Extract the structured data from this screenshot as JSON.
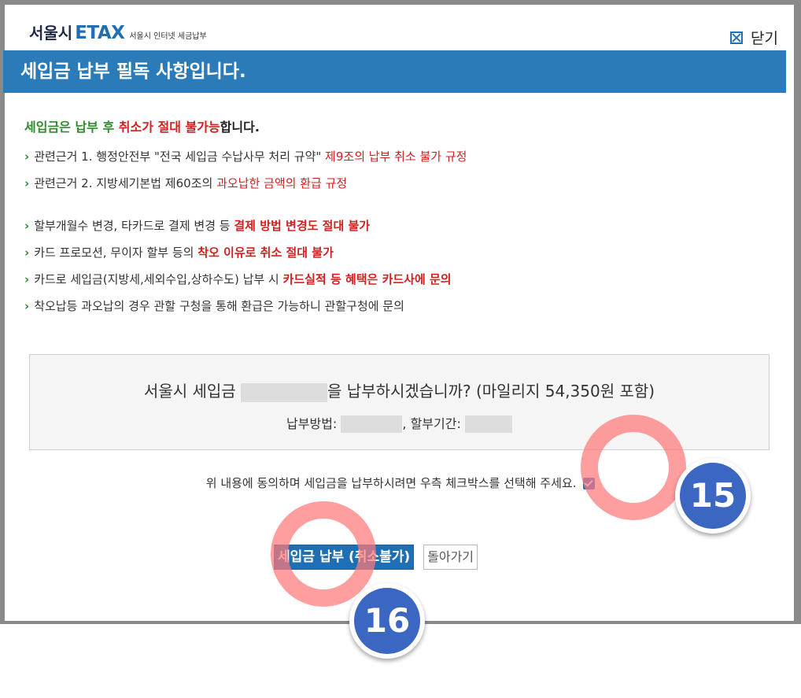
{
  "header": {
    "logo_seoul": "서울시",
    "logo_etax": "ETAX",
    "logo_sub": "서울시 인터넷 세금납부",
    "close_label": "닫기"
  },
  "title": "세입금 납부 필독 사항입니다.",
  "notice": {
    "headline_a": "세입금은 납부 후 ",
    "headline_b": "취소가 절대 불가능",
    "headline_c": "합니다.",
    "items": [
      {
        "text": "관련근거 1. 행정안전부 \"전국 세입금 수납사무 처리 규약\" ",
        "highlight": "제9조의 납부 취소 불가 규정"
      },
      {
        "text": "관련근거 2. 지방세기본법 제60조의 ",
        "highlight": "과오납한 금액의 환급 규정"
      },
      {
        "text": "할부개월수 변경, 타카드로 결제 변경 등 ",
        "highlight": "결제 방법 변경도 절대 불가"
      },
      {
        "text": "카드 프로모션, 무이자 할부 등의 ",
        "highlight": "착오 이유로 취소 절대 불가"
      },
      {
        "text": "카드로 세입금(지방세,세외수입,상하수도) 납부 시 ",
        "highlight": "카드실적 등 혜택은 카드사에 문의"
      },
      {
        "text": "착오납등 과오납의 경우 관할 구청을 통해 환급은 가능하니 관할구청에 문의",
        "highlight": ""
      }
    ]
  },
  "confirm": {
    "main_prefix": "서울시 세입금 ",
    "main_suffix": "을 납부하시겠습니까? (마일리지 54,350원 포함)",
    "method_label": "납부방법: ",
    "period_label": ", 할부기간: "
  },
  "agree_text": "위 내용에 동의하며 세입금을 납부하시려면 우측 체크박스를 선택해 주세요.",
  "buttons": {
    "pay": "세입금 납부 (취소불가)",
    "back": "돌아가기"
  },
  "annotations": [
    "15",
    "16"
  ],
  "colors": {
    "title_bar": "#2b7bb9",
    "highlight_red": "#d32020",
    "headline_green": "#2e8b2e",
    "badge_blue": "#3b66c2",
    "ring_pink": "#ff7878"
  }
}
